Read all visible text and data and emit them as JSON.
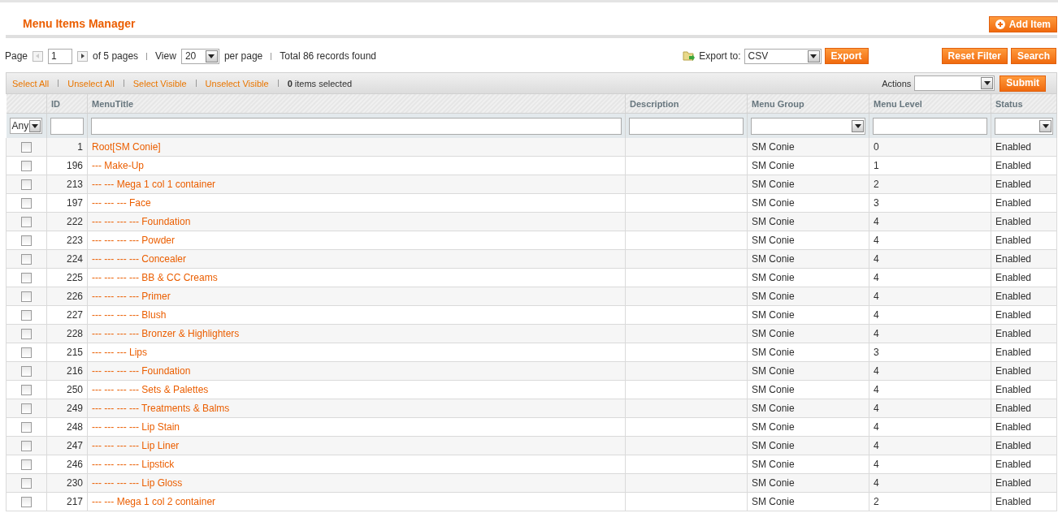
{
  "header": {
    "title": "Menu Items Manager",
    "add_button": "Add Item"
  },
  "pager": {
    "page_label": "Page",
    "page": "1",
    "of_pages": "of 5 pages",
    "view_label": "View",
    "per_page": "20",
    "per_page_label": "per page",
    "total": "Total 86 records found"
  },
  "export": {
    "label": "Export to:",
    "format": "CSV",
    "button": "Export"
  },
  "filter_buttons": [
    "Reset Filter",
    "Search"
  ],
  "massaction": {
    "links": [
      "Select All",
      "Unselect All",
      "Select Visible",
      "Unselect Visible"
    ],
    "count": "0",
    "count_label": "items selected",
    "actions_label": "Actions",
    "submit": "Submit"
  },
  "table": {
    "columns": [
      "ID",
      "MenuTitle",
      "Description",
      "Menu Group",
      "Menu Level",
      "Status"
    ],
    "filters": {
      "select_any": "Any"
    },
    "rows": [
      {
        "checked": false,
        "id": "1",
        "title": "Root[SM Conie]",
        "group": "SM Conie",
        "level": "0",
        "status": "Enabled"
      },
      {
        "checked": false,
        "id": "196",
        "title": "--- Make-Up",
        "group": "SM Conie",
        "level": "1",
        "status": "Enabled"
      },
      {
        "checked": false,
        "id": "213",
        "title": "--- --- Mega 1 col 1 container",
        "group": "SM Conie",
        "level": "2",
        "status": "Enabled"
      },
      {
        "checked": false,
        "id": "197",
        "title": "--- --- --- Face",
        "group": "SM Conie",
        "level": "3",
        "status": "Enabled"
      },
      {
        "checked": false,
        "id": "222",
        "title": "--- --- --- --- Foundation",
        "group": "SM Conie",
        "level": "4",
        "status": "Enabled"
      },
      {
        "checked": false,
        "id": "223",
        "title": "--- --- --- --- Powder",
        "group": "SM Conie",
        "level": "4",
        "status": "Enabled"
      },
      {
        "checked": false,
        "id": "224",
        "title": "--- --- --- --- Concealer",
        "group": "SM Conie",
        "level": "4",
        "status": "Enabled"
      },
      {
        "checked": false,
        "id": "225",
        "title": "--- --- --- --- BB & CC Creams",
        "group": "SM Conie",
        "level": "4",
        "status": "Enabled"
      },
      {
        "checked": false,
        "id": "226",
        "title": "--- --- --- --- Primer",
        "group": "SM Conie",
        "level": "4",
        "status": "Enabled"
      },
      {
        "checked": false,
        "id": "227",
        "title": "--- --- --- --- Blush",
        "group": "SM Conie",
        "level": "4",
        "status": "Enabled"
      },
      {
        "checked": false,
        "id": "228",
        "title": "--- --- --- --- Bronzer & Highlighters",
        "group": "SM Conie",
        "level": "4",
        "status": "Enabled"
      },
      {
        "checked": false,
        "id": "215",
        "title": "--- --- --- Lips",
        "group": "SM Conie",
        "level": "3",
        "status": "Enabled"
      },
      {
        "checked": false,
        "id": "216",
        "title": "--- --- --- --- Foundation",
        "group": "SM Conie",
        "level": "4",
        "status": "Enabled"
      },
      {
        "checked": false,
        "id": "250",
        "title": "--- --- --- --- Sets & Palettes",
        "group": "SM Conie",
        "level": "4",
        "status": "Enabled"
      },
      {
        "checked": false,
        "id": "249",
        "title": "--- --- --- --- Treatments & Balms",
        "group": "SM Conie",
        "level": "4",
        "status": "Enabled"
      },
      {
        "checked": false,
        "id": "248",
        "title": "--- --- --- --- Lip Stain",
        "group": "SM Conie",
        "level": "4",
        "status": "Enabled"
      },
      {
        "checked": false,
        "id": "247",
        "title": "--- --- --- --- Lip Liner",
        "group": "SM Conie",
        "level": "4",
        "status": "Enabled"
      },
      {
        "checked": false,
        "id": "246",
        "title": "--- --- --- --- Lipstick",
        "group": "SM Conie",
        "level": "4",
        "status": "Enabled"
      },
      {
        "checked": false,
        "id": "230",
        "title": "--- --- --- --- Lip Gloss",
        "group": "SM Conie",
        "level": "4",
        "status": "Enabled"
      },
      {
        "checked": false,
        "id": "217",
        "title": "--- --- Mega 1 col 2 container",
        "group": "SM Conie",
        "level": "2",
        "status": "Enabled"
      }
    ]
  }
}
